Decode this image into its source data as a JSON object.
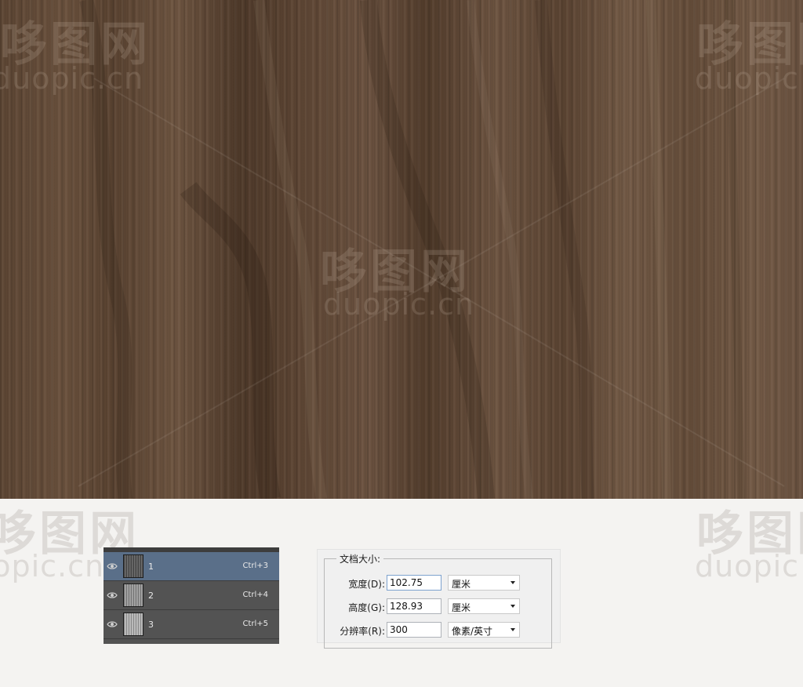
{
  "watermark": {
    "brand": "哆图网",
    "url": "duopic.cn",
    "url_fragment_left": "duopic.cn",
    "url_fragment_right": "duopic"
  },
  "layers_panel": {
    "layers": [
      {
        "name": "1",
        "shortcut": "Ctrl+3",
        "selected": true,
        "thumb_color": "#5a5a5a"
      },
      {
        "name": "2",
        "shortcut": "Ctrl+4",
        "selected": false,
        "thumb_color": "#9a9a9a"
      },
      {
        "name": "3",
        "shortcut": "Ctrl+5",
        "selected": false,
        "thumb_color": "#b5b5b5"
      }
    ],
    "icon": "eye-icon"
  },
  "document_size": {
    "title": "文档大小:",
    "width_label": "宽度(D):",
    "width_value": "102.75",
    "width_unit": "厘米",
    "height_label": "高度(G):",
    "height_value": "128.93",
    "height_unit": "厘米",
    "resolution_label": "分辨率(R):",
    "resolution_value": "300",
    "resolution_unit": "像素/英寸"
  },
  "colors": {
    "wood_base": "#5f4735",
    "selected_layer": "#5a6f89",
    "panel_bg": "#535353",
    "page_bg": "#f4f3f1"
  }
}
